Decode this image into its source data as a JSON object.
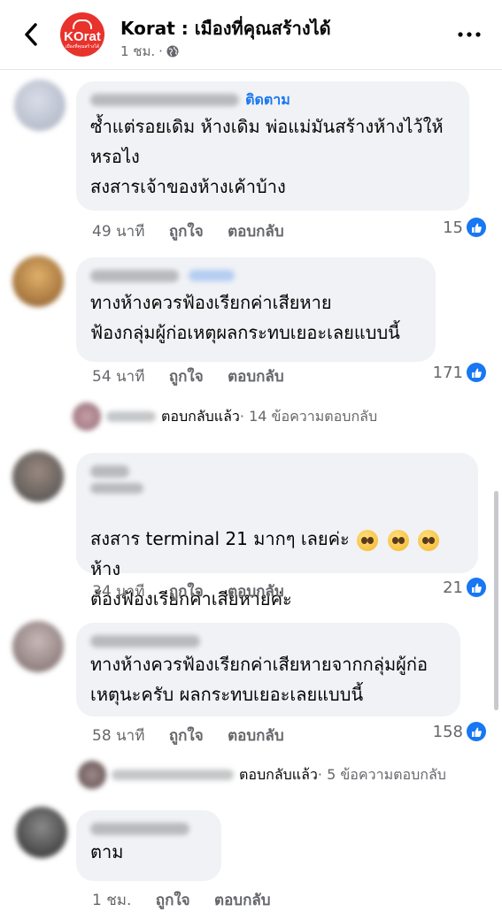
{
  "header": {
    "page_name": "Korat : เมืองที่คุณสร้างได้",
    "time": "1 ชม.",
    "logo_text": "KOrat",
    "logo_sub": "เมืองที่คุณสร้างได้"
  },
  "comments": [
    {
      "follow_label": "ติดตาม",
      "text": "ซ้ำแต่รอยเดิม ห้างเดิม พ่อแม่มันสร้างห้างไว้ให้\nหรอไง\nสงสารเจ้าของห้างเค้าบ้าง",
      "time": "49 นาที",
      "like": "ถูกใจ",
      "reply": "ตอบกลับ",
      "likes": "15"
    },
    {
      "text": "ทางห้างควรฟ้องเรียกค่าเสียหาย\nฟ้องกลุ่มผู้ก่อเหตุผลกระทบเยอะเลยแบบนี้",
      "time": "54 นาที",
      "like": "ถูกใจ",
      "reply": "ตอบกลับ",
      "likes": "171",
      "replied_label": "ตอบกลับแล้ว",
      "reply_count": " · 14 ข้อความตอบกลับ"
    },
    {
      "text_line1": "สงสาร terminal 21 มากๆ เลยค่ะ ",
      "text_line1_end": "ห้าง",
      "text_line2": "ต้องฟ้องเรียกค่าเสียหายค่ะ",
      "time": "34 นาที",
      "like": "ถูกใจ",
      "reply": "ตอบกลับ",
      "likes": "21"
    },
    {
      "text": "ทางห้างควรฟ้องเรียกค่าเสียหายจากกลุ่มผู้ก่อ\nเหตุนะครับ ผลกระทบเยอะเลยแบบนี้",
      "time": "58 นาที",
      "like": "ถูกใจ",
      "reply": "ตอบกลับ",
      "likes": "158",
      "replied_label": "ตอบกลับแล้ว",
      "reply_count": " · 5 ข้อความตอบกลับ"
    },
    {
      "text": "ตาม",
      "time": "1 ชม.",
      "like": "ถูกใจ",
      "reply": "ตอบกลับ"
    }
  ],
  "colors": {
    "accent": "#1877f2",
    "bubble": "#f0f2f5",
    "secondary_text": "#65676b",
    "logo_red": "#e8322b"
  },
  "icons": [
    "back-arrow-icon",
    "globe-icon",
    "more-icon",
    "like-thumb-icon",
    "pleading-face-emoji"
  ]
}
